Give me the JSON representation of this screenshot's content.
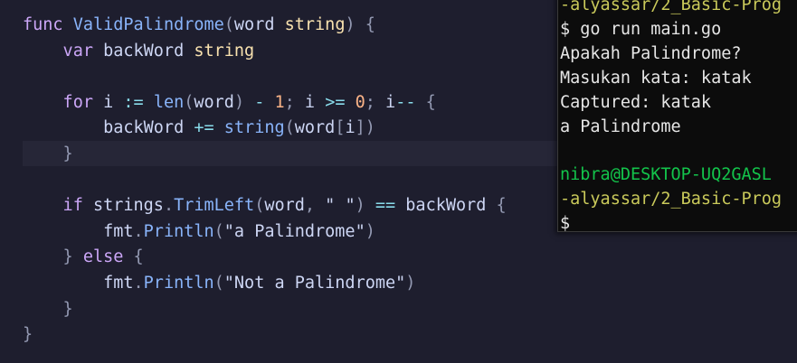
{
  "editor": {
    "lines": [
      {
        "tokens": [
          {
            "t": "func ",
            "c": "kw"
          },
          {
            "t": "ValidPalindrome",
            "c": "fn"
          },
          {
            "t": "(",
            "c": "punc"
          },
          {
            "t": "word ",
            "c": "plain"
          },
          {
            "t": "string",
            "c": "type"
          },
          {
            "t": ") {",
            "c": "punc"
          }
        ]
      },
      {
        "tokens": [
          {
            "t": "    var ",
            "c": "kw"
          },
          {
            "t": "backWord ",
            "c": "plain"
          },
          {
            "t": "string",
            "c": "type"
          }
        ]
      },
      {
        "tokens": []
      },
      {
        "tokens": [
          {
            "t": "    for ",
            "c": "kw"
          },
          {
            "t": "i ",
            "c": "plain"
          },
          {
            "t": ":= ",
            "c": "op"
          },
          {
            "t": "len",
            "c": "fn"
          },
          {
            "t": "(",
            "c": "punc"
          },
          {
            "t": "word",
            "c": "plain"
          },
          {
            "t": ") ",
            "c": "punc"
          },
          {
            "t": "- ",
            "c": "op"
          },
          {
            "t": "1",
            "c": "num"
          },
          {
            "t": "; ",
            "c": "punc"
          },
          {
            "t": "i ",
            "c": "plain"
          },
          {
            "t": ">= ",
            "c": "op"
          },
          {
            "t": "0",
            "c": "num"
          },
          {
            "t": "; ",
            "c": "punc"
          },
          {
            "t": "i",
            "c": "plain"
          },
          {
            "t": "-- ",
            "c": "op"
          },
          {
            "t": "{",
            "c": "punc"
          }
        ]
      },
      {
        "tokens": [
          {
            "t": "        backWord ",
            "c": "plain"
          },
          {
            "t": "+= ",
            "c": "op"
          },
          {
            "t": "string",
            "c": "fn"
          },
          {
            "t": "(",
            "c": "punc"
          },
          {
            "t": "word",
            "c": "plain"
          },
          {
            "t": "[",
            "c": "punc"
          },
          {
            "t": "i",
            "c": "plain"
          },
          {
            "t": "])",
            "c": "punc"
          }
        ]
      },
      {
        "tokens": [
          {
            "t": "    }",
            "c": "punc"
          }
        ]
      },
      {
        "tokens": []
      },
      {
        "tokens": [
          {
            "t": "    if ",
            "c": "kw"
          },
          {
            "t": "strings",
            "c": "plain"
          },
          {
            "t": ".",
            "c": "punc"
          },
          {
            "t": "TrimLeft",
            "c": "fn"
          },
          {
            "t": "(",
            "c": "punc"
          },
          {
            "t": "word",
            "c": "plain"
          },
          {
            "t": ", ",
            "c": "punc"
          },
          {
            "t": "\" \"",
            "c": "plain"
          },
          {
            "t": ") ",
            "c": "punc"
          },
          {
            "t": "== ",
            "c": "op"
          },
          {
            "t": "backWord ",
            "c": "plain"
          },
          {
            "t": "{",
            "c": "punc"
          }
        ]
      },
      {
        "tokens": [
          {
            "t": "        fmt",
            "c": "plain"
          },
          {
            "t": ".",
            "c": "punc"
          },
          {
            "t": "Println",
            "c": "fn"
          },
          {
            "t": "(",
            "c": "punc"
          },
          {
            "t": "\"a Palindrome\"",
            "c": "plain"
          },
          {
            "t": ")",
            "c": "punc"
          }
        ]
      },
      {
        "tokens": [
          {
            "t": "    } ",
            "c": "punc"
          },
          {
            "t": "else ",
            "c": "kw"
          },
          {
            "t": "{",
            "c": "punc"
          }
        ]
      },
      {
        "tokens": [
          {
            "t": "        fmt",
            "c": "plain"
          },
          {
            "t": ".",
            "c": "punc"
          },
          {
            "t": "Println",
            "c": "fn"
          },
          {
            "t": "(",
            "c": "punc"
          },
          {
            "t": "\"Not a Palindrome\"",
            "c": "plain"
          },
          {
            "t": ")",
            "c": "punc"
          }
        ]
      },
      {
        "tokens": [
          {
            "t": "    }",
            "c": "punc"
          }
        ]
      },
      {
        "tokens": [
          {
            "t": "}",
            "c": "punc"
          }
        ]
      }
    ]
  },
  "terminal": {
    "lines": [
      {
        "text": "-alyassar/2_Basic-Prog",
        "style": "yellow"
      },
      {
        "text": "$ go run main.go",
        "style": "plain"
      },
      {
        "text": "Apakah Palindrome?",
        "style": "plain"
      },
      {
        "text": "Masukan kata: katak",
        "style": "plain"
      },
      {
        "text": "Captured: katak",
        "style": "plain"
      },
      {
        "text": "a Palindrome",
        "style": "plain"
      },
      {
        "text": "",
        "style": "plain"
      },
      {
        "text": "nibra@DESKTOP-UQ2GASL",
        "style": "green"
      },
      {
        "text": "-alyassar/2_Basic-Prog",
        "style": "yellow"
      },
      {
        "text": "$",
        "style": "plain"
      }
    ]
  },
  "colors": {
    "editor_bg": "#1e1e2e",
    "terminal_bg": "#0c0c0c",
    "keyword": "#cba6f7",
    "function": "#89b4fa",
    "type": "#f9e2af",
    "number": "#fab387",
    "operator": "#89dceb",
    "prompt_user": "#13c44b",
    "prompt_path": "#c9c95a"
  }
}
